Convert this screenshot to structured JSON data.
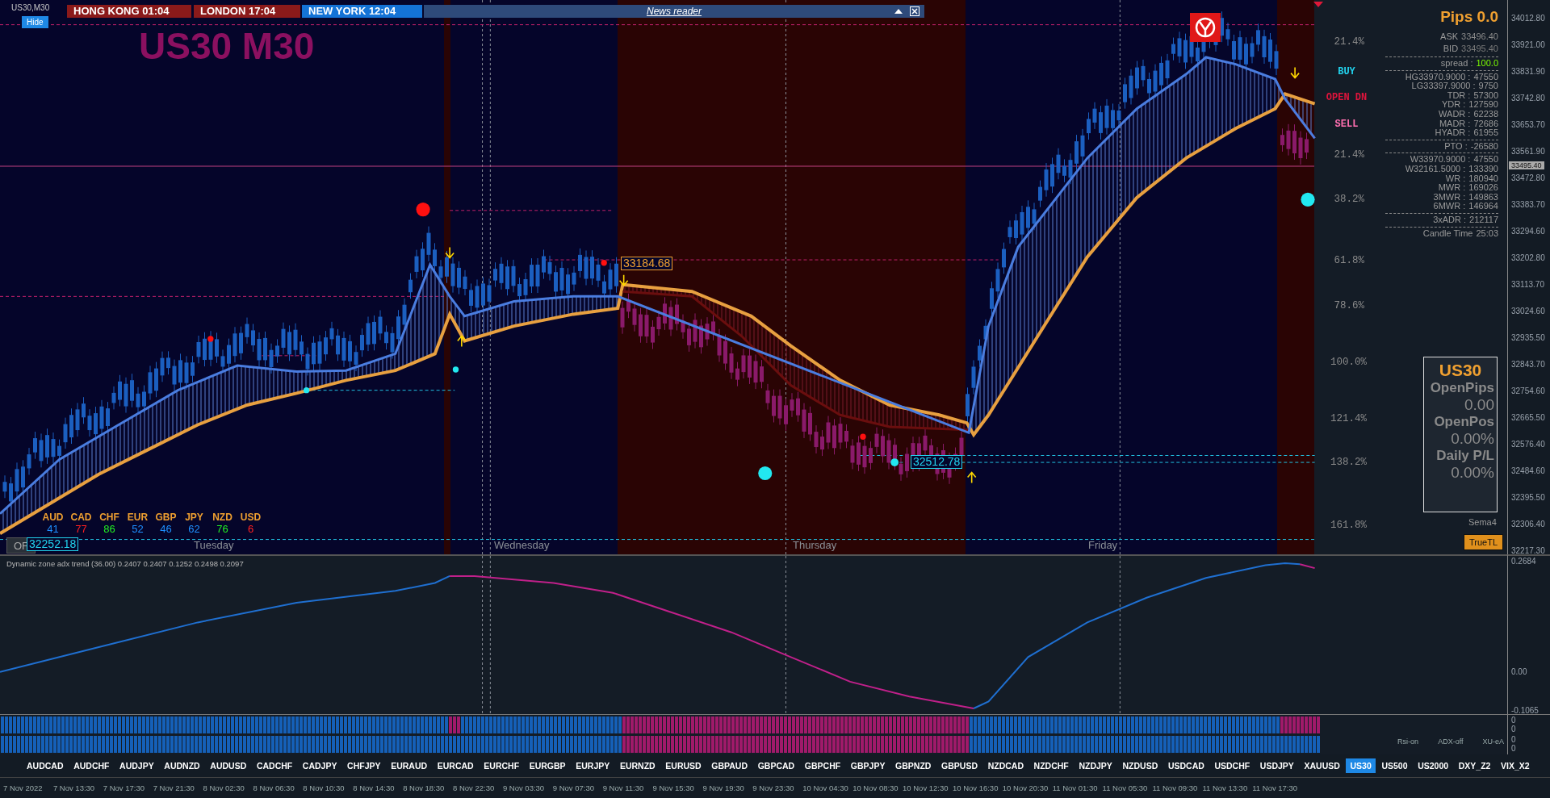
{
  "window": {
    "title": "US30,M30",
    "hide_button": "Hide",
    "symbol_heading": "US30 M30"
  },
  "session_clocks": [
    {
      "label": "HONG KONG  01:04",
      "color": "#8b1a1a"
    },
    {
      "label": "LONDON  17:04",
      "color": "#8b1a1a"
    },
    {
      "label": "NEW YORK  12:04",
      "color": "#1473d6"
    }
  ],
  "news_reader": {
    "title": "News reader"
  },
  "trade_signals": [
    {
      "label": "BUY",
      "color": "#22d3ee"
    },
    {
      "label": "OPEN DN",
      "color": "#e0143c"
    },
    {
      "label": "SELL",
      "color": "#ff6fb0"
    }
  ],
  "fib_levels": [
    "21.4%",
    "21.4%",
    "38.2%",
    "61.8%",
    "78.6%",
    "100.0%",
    "121.4%",
    "138.2%",
    "161.8%"
  ],
  "price_tags": [
    {
      "label": "33184.68",
      "color": "#f0a030"
    },
    {
      "label": "32512.78",
      "color": "#22d3ee"
    },
    {
      "label": "32252.18",
      "color": "#22d3ee"
    }
  ],
  "or_button": "OF",
  "currency_strength": [
    {
      "name": "AUD",
      "value": "41",
      "color": "#1e90ff"
    },
    {
      "name": "CAD",
      "value": "77",
      "color": "#ff2020"
    },
    {
      "name": "CHF",
      "value": "86",
      "color": "#22ee22"
    },
    {
      "name": "EUR",
      "value": "52",
      "color": "#1e90ff"
    },
    {
      "name": "GBP",
      "value": "46",
      "color": "#1e90ff"
    },
    {
      "name": "JPY",
      "value": "62",
      "color": "#1e90ff"
    },
    {
      "name": "NZD",
      "value": "76",
      "color": "#22ee22"
    },
    {
      "name": "USD",
      "value": "6",
      "color": "#ff2020"
    }
  ],
  "day_labels": [
    "Tuesday",
    "Wednesday",
    "Thursday",
    "Friday"
  ],
  "info_panel": {
    "pips": "Pips 0.0",
    "rows": [
      {
        "label": "ASK",
        "value": "33496.40",
        "kind": "ask",
        "divider_above": false
      },
      {
        "label": "BID",
        "value": "33495.40",
        "kind": "bid",
        "divider_above": false
      },
      {
        "label": "spread :",
        "value": "100.0",
        "kind": "spread",
        "divider_above": true
      },
      {
        "label": "HG33970.9000 :",
        "value": "47550",
        "kind": "stat",
        "divider_above": true
      },
      {
        "label": "LG33397.9000 :",
        "value": "9750",
        "kind": "stat",
        "divider_above": false
      },
      {
        "label": "TDR :",
        "value": "57300",
        "kind": "stat",
        "divider_above": false
      },
      {
        "label": "YDR :",
        "value": "127590",
        "kind": "stat",
        "divider_above": false
      },
      {
        "label": "WADR :",
        "value": "62238",
        "kind": "stat",
        "divider_above": false
      },
      {
        "label": "MADR :",
        "value": "72686",
        "kind": "stat",
        "divider_above": false
      },
      {
        "label": "HYADR :",
        "value": "61955",
        "kind": "stat",
        "divider_above": false
      },
      {
        "label": "PTO :",
        "value": "-26580",
        "kind": "stat",
        "divider_above": true
      },
      {
        "label": "W33970.9000 :",
        "value": "47550",
        "kind": "stat",
        "divider_above": true
      },
      {
        "label": "W32161.5000 :",
        "value": "133390",
        "kind": "stat",
        "divider_above": false
      },
      {
        "label": "WR :",
        "value": "180940",
        "kind": "stat",
        "divider_above": false
      },
      {
        "label": "MWR :",
        "value": "169026",
        "kind": "stat",
        "divider_above": false
      },
      {
        "label": "3MWR :",
        "value": "149863",
        "kind": "stat",
        "divider_above": false
      },
      {
        "label": "6MWR :",
        "value": "146964",
        "kind": "stat",
        "divider_above": false
      },
      {
        "label": "3xADR :",
        "value": "212117",
        "kind": "stat",
        "divider_above": true
      },
      {
        "label": "Candle Time",
        "value": "25:03",
        "kind": "stat",
        "divider_above": true
      }
    ]
  },
  "account_box": {
    "symbol": "US30",
    "items": [
      {
        "label": "OpenPips",
        "value": "0.00"
      },
      {
        "label": "OpenPos",
        "value": "0.00%"
      },
      {
        "label": "Daily P/L",
        "value": "0.00%"
      }
    ]
  },
  "sema_label": "Sema4",
  "truetl_button": "TrueTL",
  "price_axis": {
    "ticks": [
      "34012.80",
      "33921.00",
      "33831.90",
      "33742.80",
      "33653.70",
      "33561.90",
      "33472.80",
      "33383.70",
      "33294.60",
      "33202.80",
      "33113.70",
      "33024.60",
      "32935.50",
      "32843.70",
      "32754.60",
      "32665.50",
      "32576.40",
      "32484.60",
      "32395.50",
      "32306.40",
      "32217.30"
    ],
    "current": "33495.40"
  },
  "indicator": {
    "title": "Dynamic zone adx trend (36.00) 0.2407 0.2407 0.1252 0.2498 0.2097",
    "axis": [
      "0.2684",
      "0.00",
      "-0.1065"
    ]
  },
  "heatmap": {
    "rows": [
      {
        "axis": [
          "0",
          "0"
        ]
      },
      {
        "axis": [
          "0",
          "0"
        ]
      }
    ],
    "labels": [
      "Rsi-on",
      "ADX-off",
      "XU-eA"
    ]
  },
  "symbols": [
    {
      "label": "AUDCAD",
      "selected": false
    },
    {
      "label": "AUDCHF",
      "selected": false
    },
    {
      "label": "AUDJPY",
      "selected": false
    },
    {
      "label": "AUDNZD",
      "selected": false
    },
    {
      "label": "AUDUSD",
      "selected": false
    },
    {
      "label": "CADCHF",
      "selected": false
    },
    {
      "label": "CADJPY",
      "selected": false
    },
    {
      "label": "CHFJPY",
      "selected": false
    },
    {
      "label": "EURAUD",
      "selected": false
    },
    {
      "label": "EURCAD",
      "selected": false
    },
    {
      "label": "EURCHF",
      "selected": false
    },
    {
      "label": "EURGBP",
      "selected": false
    },
    {
      "label": "EURJPY",
      "selected": false
    },
    {
      "label": "EURNZD",
      "selected": false
    },
    {
      "label": "EURUSD",
      "selected": false
    },
    {
      "label": "GBPAUD",
      "selected": false
    },
    {
      "label": "GBPCAD",
      "selected": false
    },
    {
      "label": "GBPCHF",
      "selected": false
    },
    {
      "label": "GBPJPY",
      "selected": false
    },
    {
      "label": "GBPNZD",
      "selected": false
    },
    {
      "label": "GBPUSD",
      "selected": false
    },
    {
      "label": "NZDCAD",
      "selected": false
    },
    {
      "label": "NZDCHF",
      "selected": false
    },
    {
      "label": "NZDJPY",
      "selected": false
    },
    {
      "label": "NZDUSD",
      "selected": false
    },
    {
      "label": "USDCAD",
      "selected": false
    },
    {
      "label": "USDCHF",
      "selected": false
    },
    {
      "label": "USDJPY",
      "selected": false
    },
    {
      "label": "XAUUSD",
      "selected": false
    },
    {
      "label": "US30",
      "selected": true
    },
    {
      "label": "US500",
      "selected": false
    },
    {
      "label": "US2000",
      "selected": false
    },
    {
      "label": "DXY_Z2",
      "selected": false
    },
    {
      "label": "VIX_X2",
      "selected": false
    }
  ],
  "time_axis": [
    "7 Nov 2022",
    "7 Nov 13:30",
    "7 Nov 17:30",
    "7 Nov 21:30",
    "8 Nov 02:30",
    "8 Nov 06:30",
    "8 Nov 10:30",
    "8 Nov 14:30",
    "8 Nov 18:30",
    "8 Nov 22:30",
    "9 Nov 03:30",
    "9 Nov 07:30",
    "9 Nov 11:30",
    "9 Nov 15:30",
    "9 Nov 19:30",
    "9 Nov 23:30",
    "10 Nov 04:30",
    "10 Nov 08:30",
    "10 Nov 12:30",
    "10 Nov 16:30",
    "10 Nov 20:30",
    "11 Nov 01:30",
    "11 Nov 05:30",
    "11 Nov 09:30",
    "11 Nov 13:30",
    "11 Nov 17:30"
  ]
}
